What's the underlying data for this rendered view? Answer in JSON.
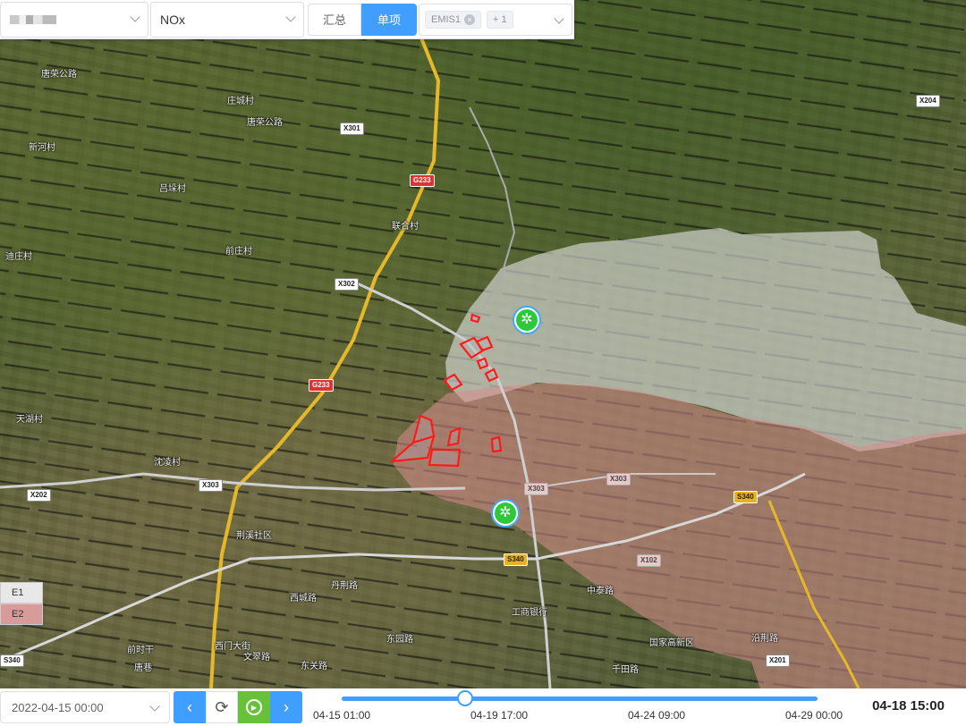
{
  "toolbar": {
    "region_value": "",
    "pollutant_value": "NOx",
    "mode_summary": "汇总",
    "mode_single": "单项",
    "source_tag": "EMIS1",
    "source_more": "+ 1"
  },
  "map": {
    "places": [
      "唐荣公路",
      "庄城村",
      "新河村",
      "唐荣公路",
      "吕垛村",
      "联合村",
      "前庄村",
      "迪庄村",
      "天湖村",
      "沈凌村",
      "荆溪社区",
      "前时干",
      "唐巷",
      "丹荆路",
      "东园路",
      "西门大街",
      "西城路",
      "文翠路",
      "东关路",
      "中泰路",
      "工商银行",
      "国家高新区",
      "沿荆路",
      "千田路"
    ],
    "roads": [
      "X301",
      "G233",
      "X302",
      "G233",
      "X202",
      "X303",
      "X303",
      "X303",
      "S340",
      "S340",
      "X102",
      "S340",
      "X204",
      "X201"
    ]
  },
  "legend": {
    "e1": "E1",
    "e2": "E2",
    "e1_color": "#e8e8e8",
    "e2_color": "#d99a9a"
  },
  "playback": {
    "start_date": "2022-04-15 00:00",
    "ticks": [
      "04-15 01:00",
      "04-19 17:00",
      "04-24 09:00",
      "04-29 00:00"
    ],
    "current_time": "04-18 15:00",
    "progress": 0.26
  }
}
